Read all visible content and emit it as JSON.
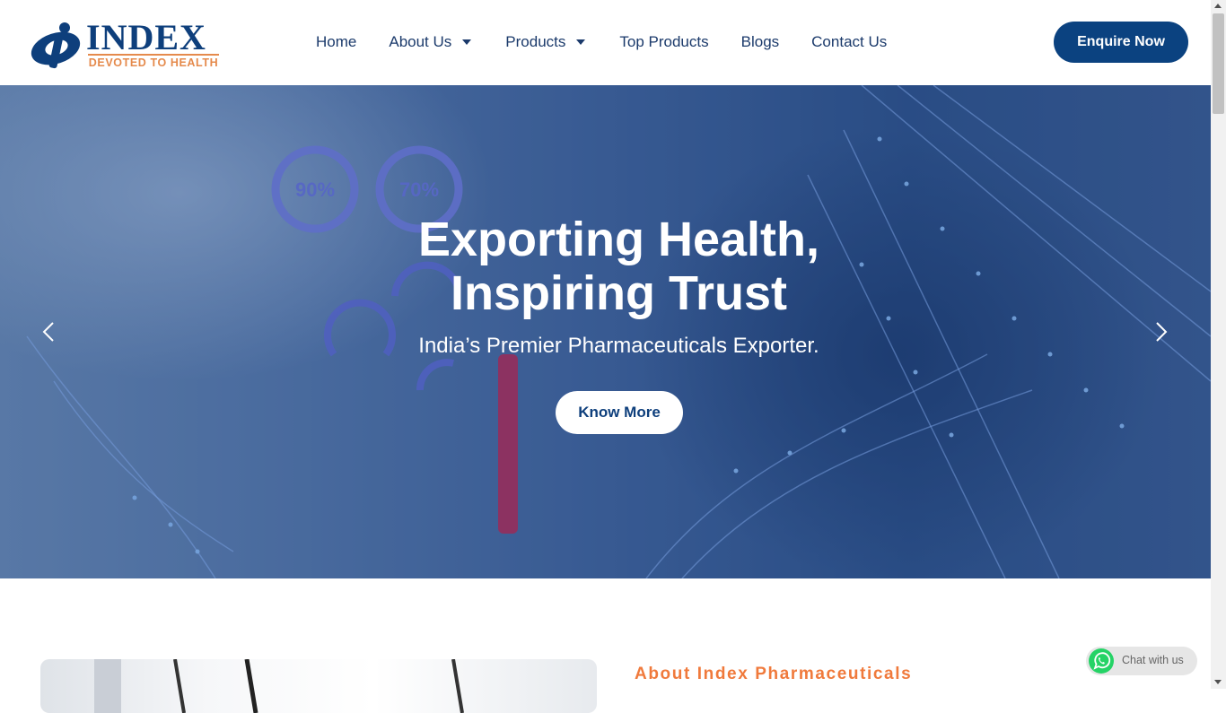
{
  "brand": {
    "name": "INDEX",
    "tagline": "DEVOTED TO HEALTH",
    "primary_color": "#0e3f7c",
    "accent_color": "#e58a4c"
  },
  "nav": {
    "items": [
      {
        "label": "Home",
        "dropdown": false
      },
      {
        "label": "About Us",
        "dropdown": true
      },
      {
        "label": "Products",
        "dropdown": true
      },
      {
        "label": "Top Products",
        "dropdown": false
      },
      {
        "label": "Blogs",
        "dropdown": false
      },
      {
        "label": "Contact Us",
        "dropdown": false
      }
    ],
    "cta_label": "Enquire Now"
  },
  "hero": {
    "title_line1": "Exporting Health,",
    "title_line2": "Inspiring Trust",
    "subtitle": "India’s Premier Pharmaceuticals Exporter.",
    "button_label": "Know More",
    "gauges": [
      "90%",
      "70%"
    ],
    "prev_icon": "chevron-left-icon",
    "next_icon": "chevron-right-icon"
  },
  "about": {
    "heading": "About Index Pharmaceuticals"
  },
  "chat": {
    "label": "Chat with us",
    "icon": "whatsapp-icon",
    "color": "#25d366"
  }
}
